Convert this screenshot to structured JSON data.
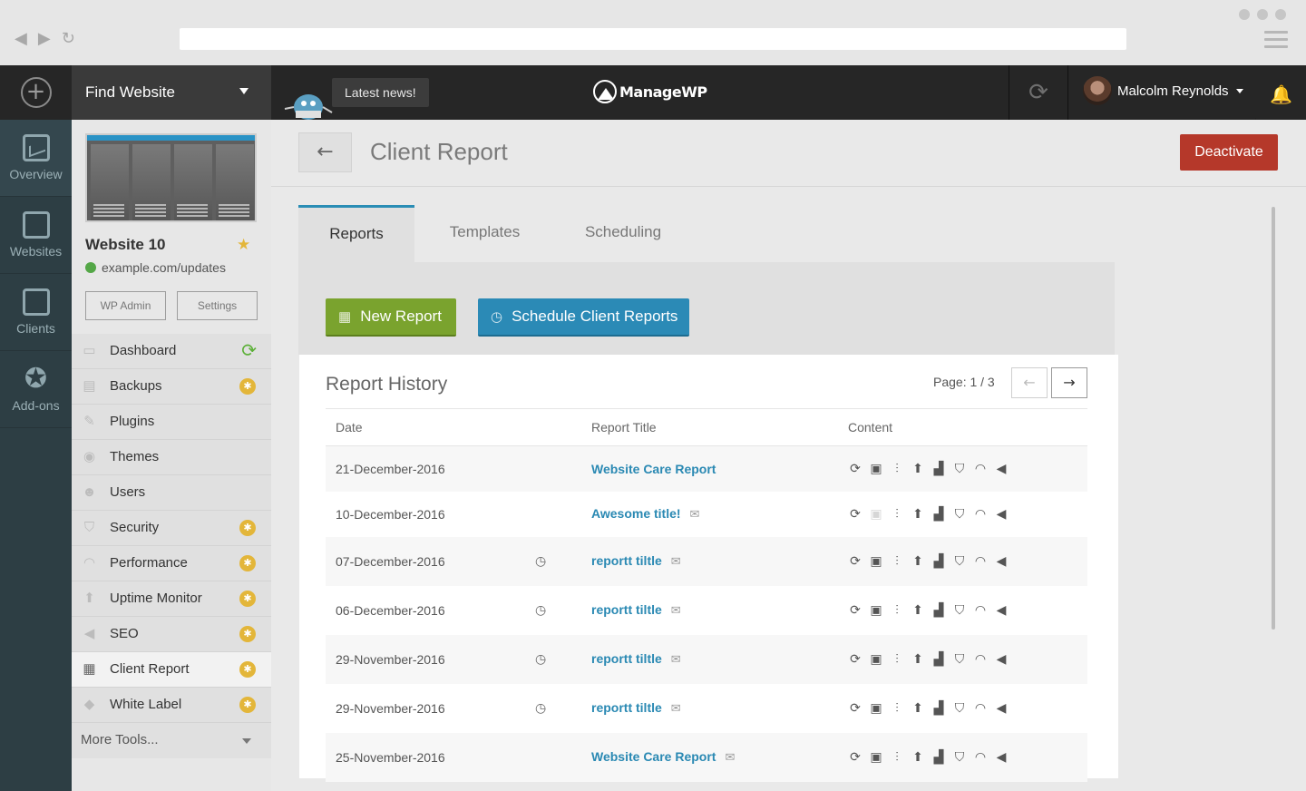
{
  "topbar": {
    "find_website": "Find Website",
    "latest_news": "Latest news!",
    "brand": "ManageWP",
    "user_name": "Malcolm Reynolds"
  },
  "rail": [
    {
      "label": "Overview",
      "icon": "overview-icon"
    },
    {
      "label": "Websites",
      "icon": "websites-icon"
    },
    {
      "label": "Clients",
      "icon": "clients-icon"
    },
    {
      "label": "Add-ons",
      "icon": "addons-icon"
    }
  ],
  "website": {
    "name": "Website 10",
    "url": "example.com/updates",
    "wp_admin": "WP Admin",
    "settings": "Settings"
  },
  "menu": [
    {
      "label": "Dashboard",
      "icon": "dashboard-icon",
      "status": "sync"
    },
    {
      "label": "Backups",
      "icon": "backups-icon",
      "status": "addon"
    },
    {
      "label": "Plugins",
      "icon": "plugins-icon",
      "status": ""
    },
    {
      "label": "Themes",
      "icon": "themes-icon",
      "status": ""
    },
    {
      "label": "Users",
      "icon": "users-icon",
      "status": ""
    },
    {
      "label": "Security",
      "icon": "security-icon",
      "status": "addon"
    },
    {
      "label": "Performance",
      "icon": "performance-icon",
      "status": "addon"
    },
    {
      "label": "Uptime Monitor",
      "icon": "uptime-icon",
      "status": "addon"
    },
    {
      "label": "SEO",
      "icon": "seo-icon",
      "status": "addon"
    },
    {
      "label": "Client Report",
      "icon": "client-report-icon",
      "status": "addon"
    },
    {
      "label": "White Label",
      "icon": "white-label-icon",
      "status": "addon"
    }
  ],
  "more_tools": "More Tools...",
  "page": {
    "title": "Client Report",
    "deactivate": "Deactivate",
    "tabs": [
      "Reports",
      "Templates",
      "Scheduling"
    ],
    "new_report": "New Report",
    "schedule_reports": "Schedule Client Reports"
  },
  "history": {
    "title": "Report History",
    "page_label": "Page: 1 / 3",
    "columns": [
      "Date",
      "Report Title",
      "Content"
    ],
    "rows": [
      {
        "date": "21-December-2016",
        "scheduled": false,
        "title": "Website Care Report",
        "emailed": false,
        "backup_included": true
      },
      {
        "date": "10-December-2016",
        "scheduled": false,
        "title": "Awesome title!",
        "emailed": true,
        "backup_included": false
      },
      {
        "date": "07-December-2016",
        "scheduled": true,
        "title": "reportt tiltle",
        "emailed": true,
        "backup_included": true
      },
      {
        "date": "06-December-2016",
        "scheduled": true,
        "title": "reportt tiltle",
        "emailed": true,
        "backup_included": true
      },
      {
        "date": "29-November-2016",
        "scheduled": true,
        "title": "reportt tiltle",
        "emailed": true,
        "backup_included": true
      },
      {
        "date": "29-November-2016",
        "scheduled": true,
        "title": "reportt tiltle",
        "emailed": true,
        "backup_included": true
      },
      {
        "date": "25-November-2016",
        "scheduled": false,
        "title": "Website Care Report",
        "emailed": true,
        "backup_included": true
      }
    ],
    "content_icons": [
      "updates-icon",
      "backup-icon",
      "plugins-icon",
      "uptime-icon",
      "analytics-icon",
      "security-icon",
      "performance-icon",
      "seo-icon"
    ]
  },
  "colors": {
    "accent": "#2a8db5",
    "new_report": "#7aa32e",
    "deactivate": "#b5382a",
    "addon_badge": "#e3b63a"
  }
}
